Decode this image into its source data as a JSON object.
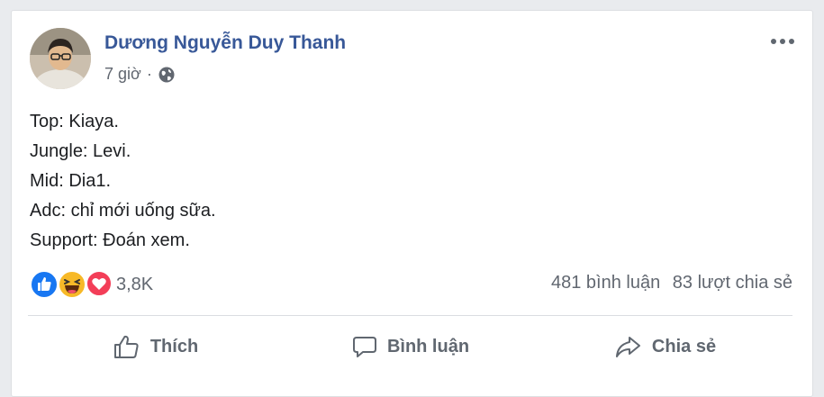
{
  "post": {
    "author": "Dương Nguyễn Duy Thanh",
    "time": "7 giờ",
    "separator": "·",
    "privacy_icon": "globe-icon",
    "menu_icon": "more-options-icon",
    "lines": [
      "Top: Kiaya.",
      "Jungle: Levi.",
      "Mid: Dia1.",
      "Adc: chỉ mới uống sữa.",
      "Support: Đoán xem."
    ],
    "reactions": {
      "icons": [
        "like-reaction-icon",
        "haha-reaction-icon",
        "love-reaction-icon"
      ],
      "count": "3,8K"
    },
    "comments": "481 bình luận",
    "shares": "83 lượt chia sẻ",
    "actions": {
      "like": "Thích",
      "comment": "Bình luận",
      "share": "Chia sẻ"
    }
  },
  "colors": {
    "author_link": "#385898",
    "like_blue": "#1877f2",
    "haha_yellow": "#f7b928",
    "love_red": "#f33e58",
    "text_gray": "#616770"
  }
}
